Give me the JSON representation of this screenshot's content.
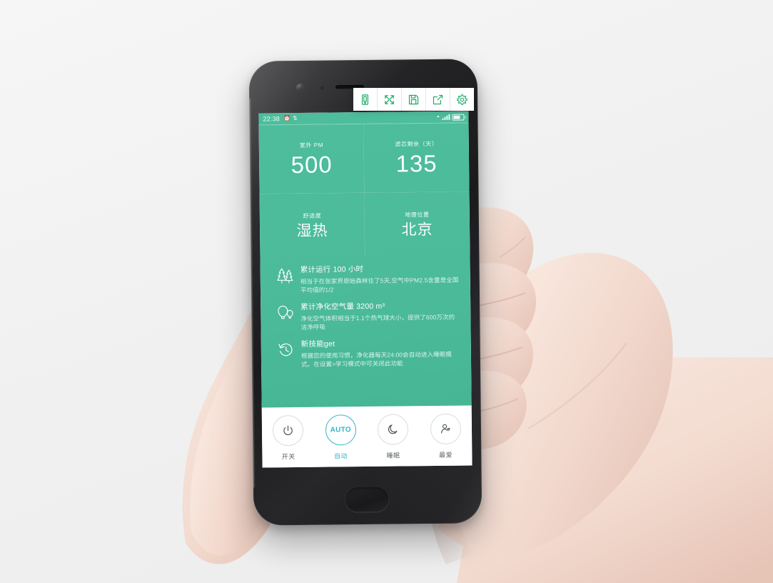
{
  "scene": {
    "background_color": "#f2f2f2",
    "description": "hand-holding-phone-mockup"
  },
  "phone": {
    "body_color": "#232326",
    "camera": "front-camera",
    "earpiece": "earpiece-speaker",
    "home_button": "home-button"
  },
  "toolbar": {
    "items": [
      {
        "icon": "device-preview-icon",
        "label": "Device"
      },
      {
        "icon": "fullscreen-expand-icon",
        "label": "Fullscreen"
      },
      {
        "icon": "save-floppy-icon",
        "label": "Save"
      },
      {
        "icon": "share-export-icon",
        "label": "Share"
      },
      {
        "icon": "settings-gear-icon",
        "label": "Settings"
      }
    ],
    "accent_color": "#17a762",
    "background_color": "#ffffff"
  },
  "status_bar": {
    "time": "22:38",
    "left_icons": [
      "alarm-icon",
      "bluetooth-icon"
    ],
    "right_icons": [
      "wifi-icon",
      "signal-icon",
      "battery-icon"
    ],
    "background_color": "#4dbd9b",
    "text_color": "#ffffff"
  },
  "app": {
    "accent_color": "#4dbd9b",
    "metrics": [
      {
        "label": "室外 PM",
        "value": "500",
        "kind": "number"
      },
      {
        "label": "滤芯剩余（天）",
        "value": "135",
        "kind": "number"
      },
      {
        "label": "舒适度",
        "value": "湿热",
        "kind": "text"
      },
      {
        "label": "地理位置",
        "value": "北京",
        "kind": "text"
      }
    ],
    "info_items": [
      {
        "icon": "pine-trees-icon",
        "title": "累计运行 100 小时",
        "desc": "相当于在张家界原始森林住了5天,空气中PM2.5含量是全国平均值的1/2"
      },
      {
        "icon": "hot-air-balloon-icon",
        "title": "累计净化空气量 3200 m³",
        "desc": "净化空气体积相当于1.1个热气球大小，提供了600万次的洁净呼吸"
      },
      {
        "icon": "clock-history-icon",
        "title": "新技能get",
        "desc": "根据您的使用习惯，净化器每天24:00会自动进入睡眠模式。在设置>学习模式中可关闭此功能"
      }
    ],
    "controls": [
      {
        "icon": "power-icon",
        "label": "开关",
        "active": false
      },
      {
        "icon": "auto-icon",
        "label": "自动",
        "badge": "AUTO",
        "active": true
      },
      {
        "icon": "moon-sleep-icon",
        "label": "睡眠",
        "active": false
      },
      {
        "icon": "favorite-person-icon",
        "label": "最爱",
        "active": false
      }
    ],
    "control_active_color": "#34b5c6",
    "control_inactive_color": "#5c6468"
  }
}
